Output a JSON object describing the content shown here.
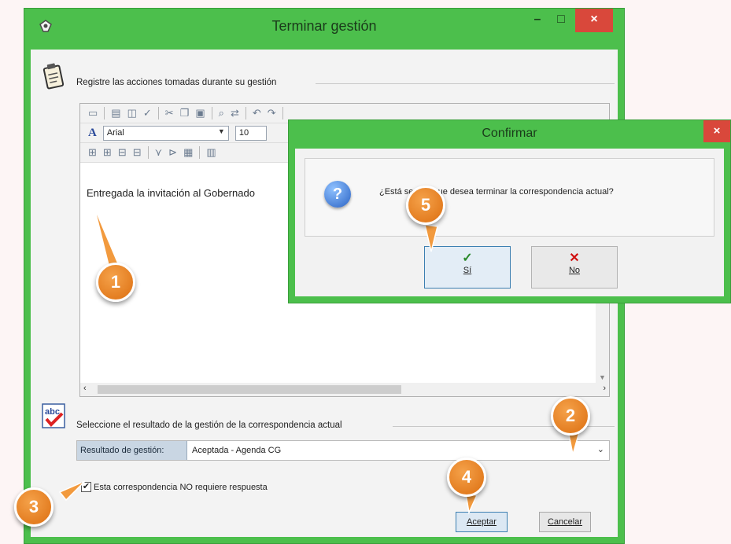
{
  "window": {
    "title": "Terminar gestión",
    "controls": {
      "minimize": "–",
      "maximize": "□",
      "close": "×"
    }
  },
  "actions_group": {
    "label": "Registre las acciones tomadas durante su gestión",
    "icon": "clipboard-icon"
  },
  "editor": {
    "font_name": "Arial",
    "font_size": "10",
    "content": "Entregada la invitación al Gobernado"
  },
  "result_group": {
    "label": "Seleccione el resultado de la gestión de la correspondencia actual",
    "icon": "spellcheck-icon",
    "field_label": "Resultado de gestión:",
    "field_value": "Aceptada - Agenda CG"
  },
  "no_response_checkbox": {
    "label": "Esta correspondencia NO requiere respuesta",
    "checked": true
  },
  "buttons": {
    "accept": "Aceptar",
    "cancel": "Cancelar"
  },
  "confirm_dialog": {
    "title": "Confirmar",
    "close": "×",
    "message": "¿Está seguro que desea terminar la correspondencia actual?",
    "yes_label": "Sí",
    "no_label": "No"
  },
  "callouts": [
    "1",
    "2",
    "3",
    "4",
    "5"
  ],
  "colors": {
    "window_frame": "#4cbf4c",
    "close_button": "#d9483b",
    "callout": "#ee8a2a"
  }
}
